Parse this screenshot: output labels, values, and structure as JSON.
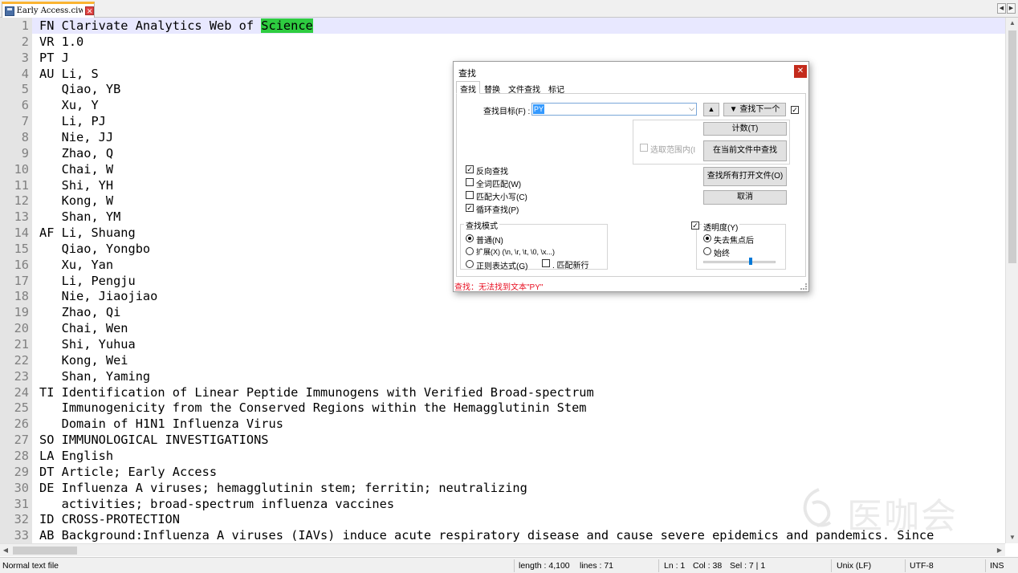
{
  "tab": {
    "title": "Early Access.ciw"
  },
  "editor": {
    "lines": [
      {
        "n": "1",
        "t": "FN Clarivate Analytics Web of ",
        "hl": "Science"
      },
      {
        "n": "2",
        "t": "VR 1.0"
      },
      {
        "n": "3",
        "t": "PT J"
      },
      {
        "n": "4",
        "t": "AU Li, S"
      },
      {
        "n": "5",
        "t": "   Qiao, YB"
      },
      {
        "n": "6",
        "t": "   Xu, Y"
      },
      {
        "n": "7",
        "t": "   Li, PJ"
      },
      {
        "n": "8",
        "t": "   Nie, JJ"
      },
      {
        "n": "9",
        "t": "   Zhao, Q"
      },
      {
        "n": "10",
        "t": "   Chai, W"
      },
      {
        "n": "11",
        "t": "   Shi, YH"
      },
      {
        "n": "12",
        "t": "   Kong, W"
      },
      {
        "n": "13",
        "t": "   Shan, YM"
      },
      {
        "n": "14",
        "t": "AF Li, Shuang"
      },
      {
        "n": "15",
        "t": "   Qiao, Yongbo"
      },
      {
        "n": "16",
        "t": "   Xu, Yan"
      },
      {
        "n": "17",
        "t": "   Li, Pengju"
      },
      {
        "n": "18",
        "t": "   Nie, Jiaojiao"
      },
      {
        "n": "19",
        "t": "   Zhao, Qi"
      },
      {
        "n": "20",
        "t": "   Chai, Wen"
      },
      {
        "n": "21",
        "t": "   Shi, Yuhua"
      },
      {
        "n": "22",
        "t": "   Kong, Wei"
      },
      {
        "n": "23",
        "t": "   Shan, Yaming"
      },
      {
        "n": "24",
        "t": "TI Identification of Linear Peptide Immunogens with Verified Broad-spectrum"
      },
      {
        "n": "25",
        "t": "   Immunogenicity from the Conserved Regions within the Hemagglutinin Stem"
      },
      {
        "n": "26",
        "t": "   Domain of H1N1 Influenza Virus"
      },
      {
        "n": "27",
        "t": "SO IMMUNOLOGICAL INVESTIGATIONS"
      },
      {
        "n": "28",
        "t": "LA English"
      },
      {
        "n": "29",
        "t": "DT Article; Early Access"
      },
      {
        "n": "30",
        "t": "DE Influenza A viruses; hemagglutinin stem; ferritin; neutralizing"
      },
      {
        "n": "31",
        "t": "   activities; broad-spectrum influenza vaccines"
      },
      {
        "n": "32",
        "t": "ID CROSS-PROTECTION"
      },
      {
        "n": "33",
        "t": "AB Background:Influenza A viruses (IAVs) induce acute respiratory disease and cause severe epidemics and pandemics. Since"
      }
    ]
  },
  "statusbar": {
    "file_type": "Normal text file",
    "length": "length : 4,100",
    "lines": "lines : 71",
    "ln": "Ln : 1",
    "col": "Col : 38",
    "sel": "Sel : 7 | 1",
    "eol": "Unix (LF)",
    "encoding": "UTF-8",
    "mode": "INS"
  },
  "watermark": {
    "text": "医咖会"
  },
  "find_dialog": {
    "title": "查找",
    "close": "✕",
    "tabs": [
      "查找",
      "替换",
      "文件查找",
      "标记"
    ],
    "find_label": "查找目标(F) :",
    "find_value": "PY",
    "up_button": "▲",
    "find_next_button": "▼ 查找下一个",
    "count_button": "计数(T)",
    "find_in_current_button": "在当前文件中查找",
    "find_all_open_button": "查找所有打开文件(O)",
    "cancel_button": "取消",
    "in_selection": "选取范围内(I",
    "options": [
      {
        "label": "反向查找",
        "checked": true
      },
      {
        "label": "全词匹配(W)",
        "checked": false
      },
      {
        "label": "匹配大小写(C)",
        "checked": false
      },
      {
        "label": "循环查找(P)",
        "checked": true
      }
    ],
    "search_mode_title": "查找模式",
    "search_modes": [
      "普通(N)",
      "扩展(X) (\\n, \\r, \\t, \\0, \\x...)",
      "正则表达式(G)"
    ],
    "search_mode_selected": 0,
    "match_newline": ". 匹配新行",
    "transparency_label": "透明度(Y)",
    "transparency_checked": true,
    "transparency_modes": [
      "失去焦点后",
      "始终"
    ],
    "transparency_selected": 0,
    "transparency_level": 0.65,
    "status": "查找：无法找到文本\"PY\""
  }
}
